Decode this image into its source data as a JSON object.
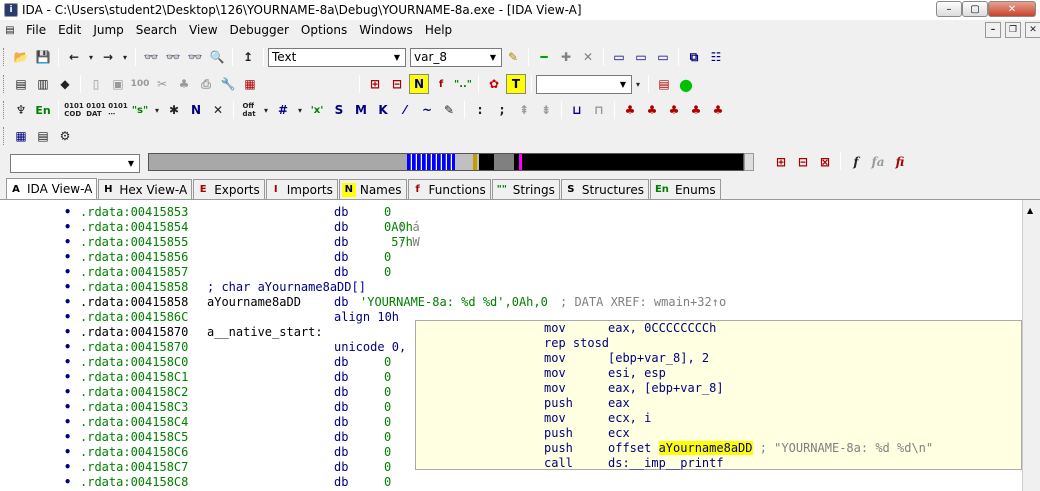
{
  "window": {
    "title": "IDA - C:\\Users\\student2\\Desktop\\126\\YOURNAME-8a\\Debug\\YOURNAME-8a.exe - [IDA View-A]",
    "min": "–",
    "max": "▢",
    "close": "✕"
  },
  "menu": [
    "File",
    "Edit",
    "Jump",
    "Search",
    "View",
    "Debugger",
    "Options",
    "Windows",
    "Help"
  ],
  "toolbar": {
    "type_combo": "Text",
    "name_combo": "var_8"
  },
  "tabs": [
    {
      "label": "IDA View-A",
      "icon": "A"
    },
    {
      "label": "Hex View-A",
      "icon": "H"
    },
    {
      "label": "Exports",
      "icon": "E"
    },
    {
      "label": "Imports",
      "icon": "I"
    },
    {
      "label": "Names",
      "icon": "N"
    },
    {
      "label": "Functions",
      "icon": "f"
    },
    {
      "label": "Strings",
      "icon": "\"\""
    },
    {
      "label": "Structures",
      "icon": "S"
    },
    {
      "label": "Enums",
      "icon": "En"
    }
  ],
  "listing": [
    {
      "addr": ".rdata:00415853",
      "label": "",
      "mn": "db",
      "op": "0",
      "cm": ""
    },
    {
      "addr": ".rdata:00415854",
      "label": "",
      "mn": "db",
      "op": "0A0h",
      "cm": "; á"
    },
    {
      "addr": ".rdata:00415855",
      "label": "",
      "mn": "db",
      "op": " 57h",
      "cm": "; W"
    },
    {
      "addr": ".rdata:00415856",
      "label": "",
      "mn": "db",
      "op": "0",
      "cm": ""
    },
    {
      "addr": ".rdata:00415857",
      "label": "",
      "mn": "db",
      "op": "0",
      "cm": ""
    },
    {
      "addr": ".rdata:00415858",
      "label": "; char aYourname8aDD[]",
      "mn": "",
      "op": "",
      "cm": ""
    },
    {
      "addr": ".rdata:00415858",
      "label": "aYourname8aDD",
      "mn": "db",
      "op": "'YOURNAME-8a: %d %d',0Ah,0",
      "cm": "; DATA XREF: wmain+32↑o"
    },
    {
      "addr": ".rdata:0041586C",
      "label": "",
      "mn": "align 10h",
      "op": "",
      "cm": ""
    },
    {
      "addr": ".rdata:00415870",
      "label": "a__native_start:",
      "mn": "",
      "op": "",
      "cm": ""
    },
    {
      "addr": ".rdata:00415870",
      "label": "",
      "mn": "unicode 0,",
      "op": "",
      "cm": ""
    },
    {
      "addr": ".rdata:004158C0",
      "label": "",
      "mn": "db",
      "op": "0",
      "cm": ""
    },
    {
      "addr": ".rdata:004158C1",
      "label": "",
      "mn": "db",
      "op": "0",
      "cm": ""
    },
    {
      "addr": ".rdata:004158C2",
      "label": "",
      "mn": "db",
      "op": "0",
      "cm": ""
    },
    {
      "addr": ".rdata:004158C3",
      "label": "",
      "mn": "db",
      "op": "0",
      "cm": ""
    },
    {
      "addr": ".rdata:004158C4",
      "label": "",
      "mn": "db",
      "op": "0",
      "cm": ""
    },
    {
      "addr": ".rdata:004158C5",
      "label": "",
      "mn": "db",
      "op": "0",
      "cm": ""
    },
    {
      "addr": ".rdata:004158C6",
      "label": "",
      "mn": "db",
      "op": "0",
      "cm": ""
    },
    {
      "addr": ".rdata:004158C7",
      "label": "",
      "mn": "db",
      "op": "0",
      "cm": ""
    },
    {
      "addr": ".rdata:004158C8",
      "label": "",
      "mn": "db",
      "op": "0",
      "cm": ""
    }
  ],
  "hint": [
    {
      "mn": "mov",
      "op": "eax, 0CCCCCCCCh",
      "cm": ""
    },
    {
      "mn": "rep stosd",
      "op": "",
      "cm": ""
    },
    {
      "mn": "mov",
      "op": "[ebp+var_8], 2",
      "cm": ""
    },
    {
      "mn": "mov",
      "op": "esi, esp",
      "cm": ""
    },
    {
      "mn": "mov",
      "op": "eax, [ebp+var_8]",
      "cm": ""
    },
    {
      "mn": "push",
      "op": "eax",
      "cm": ""
    },
    {
      "mn": "mov",
      "op": "ecx, i",
      "cm": ""
    },
    {
      "mn": "push",
      "op": "ecx",
      "cm": ""
    },
    {
      "mn": "push",
      "op": "offset ",
      "hl": "aYourname8aDD",
      "cm": " ; \"YOURNAME-8a: %d %d\\n\""
    },
    {
      "mn": "call",
      "op": "ds:__imp__printf",
      "cm": ""
    }
  ]
}
